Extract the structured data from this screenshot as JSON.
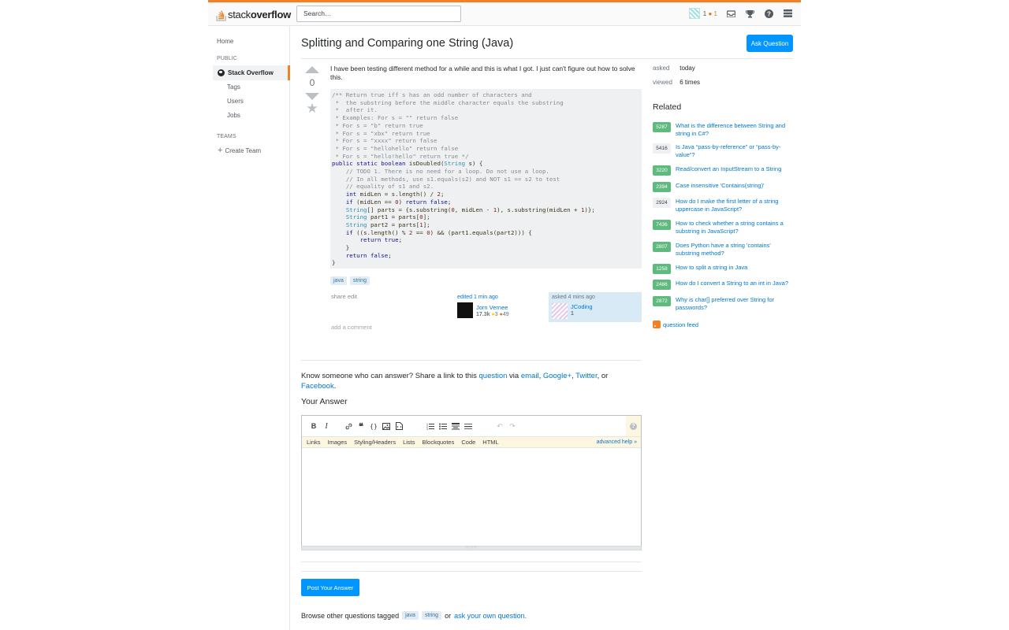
{
  "header": {
    "logo_light": "stack",
    "logo_bold": "overflow",
    "search_placeholder": "Search…",
    "user_rep": "1",
    "user_badges": "● 1"
  },
  "nav": {
    "home": "Home",
    "public": "PUBLIC",
    "stack_overflow": "Stack Overflow",
    "tags": "Tags",
    "users": "Users",
    "jobs": "Jobs",
    "teams": "TEAMS",
    "create_team": "Create Team"
  },
  "question": {
    "title": "Splitting and Comparing one String (Java)",
    "ask_button": "Ask Question",
    "votes": "0",
    "body": "I have been testing different method for a while and this is what I got. I just can't figure out how to solve this.",
    "tags": [
      "java",
      "string"
    ],
    "share": "share",
    "edit": "edit",
    "edited_label": "edited 1 min ago",
    "editor_name": "Jorn Vernee",
    "editor_rep": "17.3k",
    "editor_gold": "3",
    "editor_bronze": "49",
    "asked_label": "asked 4 mins ago",
    "asker_name": "JCoding",
    "asker_rep": "1",
    "add_comment": "add a comment"
  },
  "share_section": {
    "prefix": "Know someone who can answer? Share a link to this ",
    "question_link": "question",
    "via": " via ",
    "email": "email",
    "comma1": ", ",
    "google": "Google+",
    "comma2": ", ",
    "twitter": "Twitter",
    "or": ", or",
    "facebook": "Facebook",
    "period": "."
  },
  "answer": {
    "heading": "Your Answer",
    "help_tabs": [
      "Links",
      "Images",
      "Styling/Headers",
      "Lists",
      "Blockquotes",
      "Code",
      "HTML"
    ],
    "advanced_help": "advanced help »",
    "post_button": "Post Your Answer",
    "browse_prefix": "Browse other questions tagged",
    "browse_tags": [
      "java",
      "string"
    ],
    "browse_or": "or",
    "browse_link": "ask your own question."
  },
  "sidebar": {
    "asked_k": "asked",
    "asked_v": "today",
    "viewed_k": "viewed",
    "viewed_v": "6 times",
    "related_heading": "Related",
    "related": [
      {
        "score": "5287",
        "accepted": true,
        "title": "What is the difference between String and string in C#?"
      },
      {
        "score": "5416",
        "accepted": false,
        "title": "Is Java “pass-by-reference” or “pass-by-value”?"
      },
      {
        "score": "3220",
        "accepted": true,
        "title": "Read/convert an InputStream to a String"
      },
      {
        "score": "2394",
        "accepted": true,
        "title": "Case insensitive 'Contains(string)'"
      },
      {
        "score": "2924",
        "accepted": false,
        "title": "How do I make the first letter of a string uppercase in JavaScript?"
      },
      {
        "score": "7436",
        "accepted": true,
        "title": "How to check whether a string contains a substring in JavaScript?"
      },
      {
        "score": "2807",
        "accepted": true,
        "title": "Does Python have a string 'contains' substring method?"
      },
      {
        "score": "1258",
        "accepted": true,
        "title": "How to split a string in Java"
      },
      {
        "score": "2486",
        "accepted": true,
        "title": "How do I convert a String to an int in Java?"
      },
      {
        "score": "2872",
        "accepted": true,
        "title": "Why is char[] preferred over String for passwords?"
      }
    ],
    "feed": "question feed"
  },
  "colors": {
    "accent_orange": "#f48024",
    "button_blue": "#0095ff",
    "link_blue": "#0077cc",
    "accepted_green": "#5fba7d"
  }
}
